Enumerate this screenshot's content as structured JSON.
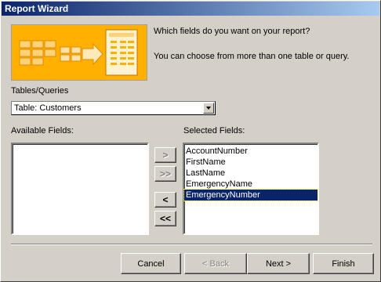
{
  "window": {
    "title": "Report Wizard"
  },
  "prompt": {
    "question": "Which fields do you want on your report?",
    "hint": "You can choose from more than one table or query."
  },
  "tables_queries": {
    "label": "Tables/Queries",
    "selected": "Table: Customers"
  },
  "available_fields": {
    "label": "Available Fields:",
    "items": []
  },
  "selected_fields": {
    "label": "Selected Fields:",
    "items": [
      "AccountNumber",
      "FirstName",
      "LastName",
      "EmergencyName",
      "EmergencyNumber"
    ],
    "highlighted": "EmergencyNumber"
  },
  "move_buttons": {
    "add_one": ">",
    "add_all": ">>",
    "remove_one": "<",
    "remove_all": "<<"
  },
  "footer": {
    "cancel": "Cancel",
    "back": "< Back",
    "next": "Next >",
    "finish": "Finish"
  },
  "colors": {
    "titlebar_start": "#0a246a",
    "titlebar_end": "#a6caf0",
    "banner": "#ffb000",
    "selection": "#0a246a",
    "face": "#d4d0c8"
  }
}
